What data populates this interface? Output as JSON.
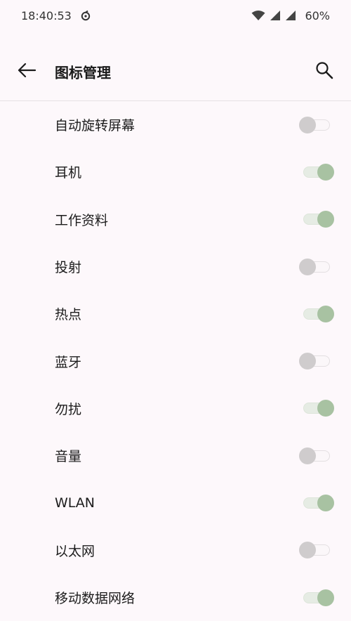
{
  "status_bar": {
    "time": "18:40:53",
    "battery": "60%",
    "icons": [
      "sync-icon",
      "wifi-icon",
      "signal-icon",
      "signal-icon"
    ]
  },
  "app_bar": {
    "title": "图标管理",
    "back_icon": "back-arrow-icon",
    "search_icon": "search-icon"
  },
  "colors": {
    "background": "#fdf8fb",
    "switch_on": "#a8c2a2",
    "switch_off": "#cfcccd"
  },
  "items": [
    {
      "label": "自动旋转屏幕",
      "enabled": false
    },
    {
      "label": "耳机",
      "enabled": true
    },
    {
      "label": "工作资料",
      "enabled": true
    },
    {
      "label": "投射",
      "enabled": false
    },
    {
      "label": "热点",
      "enabled": true
    },
    {
      "label": "蓝牙",
      "enabled": false
    },
    {
      "label": "勿扰",
      "enabled": true
    },
    {
      "label": "音量",
      "enabled": false
    },
    {
      "label": "WLAN",
      "enabled": true
    },
    {
      "label": "以太网",
      "enabled": false
    },
    {
      "label": "移动数据网络",
      "enabled": true
    }
  ]
}
